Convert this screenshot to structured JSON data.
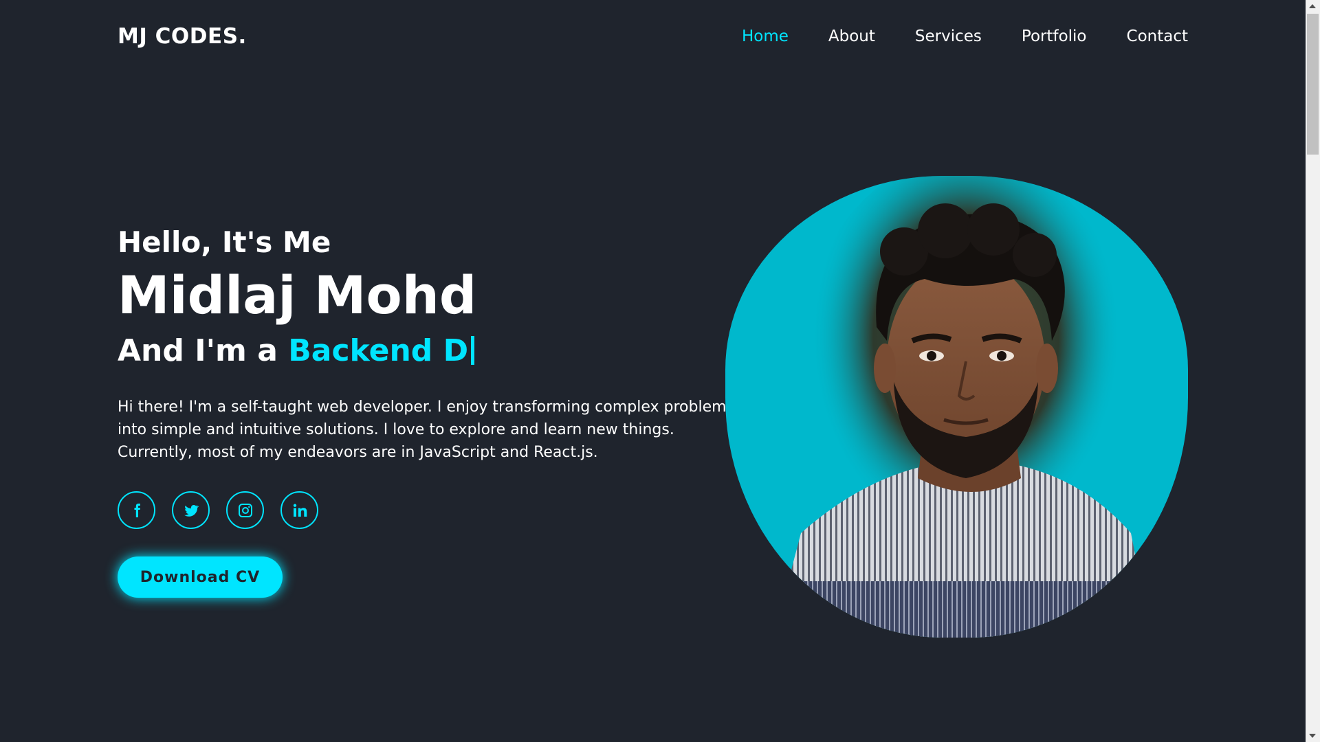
{
  "header": {
    "logo": "MJ CODES.",
    "nav": [
      {
        "label": "Home",
        "active": true
      },
      {
        "label": "About",
        "active": false
      },
      {
        "label": "Services",
        "active": false
      },
      {
        "label": "Portfolio",
        "active": false
      },
      {
        "label": "Contact",
        "active": false
      }
    ]
  },
  "hero": {
    "greeting": "Hello, It's Me",
    "name": "Midlaj Mohd",
    "role_prefix": "And I'm a ",
    "role_typed": "Backend D",
    "bio_lines": [
      "Hi there! I'm a self-taught web developer. I enjoy transforming complex problems",
      "into simple and intuitive solutions. I love to explore and learn new things.",
      "Currently, most of my endeavors are in JavaScript and React.js."
    ],
    "socials": [
      {
        "icon": "facebook-icon"
      },
      {
        "icon": "twitter-icon"
      },
      {
        "icon": "instagram-icon"
      },
      {
        "icon": "linkedin-icon"
      }
    ],
    "cv_button": "Download CV"
  },
  "colors": {
    "background": "#1f242d",
    "accent": "#00e5ff",
    "portrait_bg": "#00b8cc"
  }
}
